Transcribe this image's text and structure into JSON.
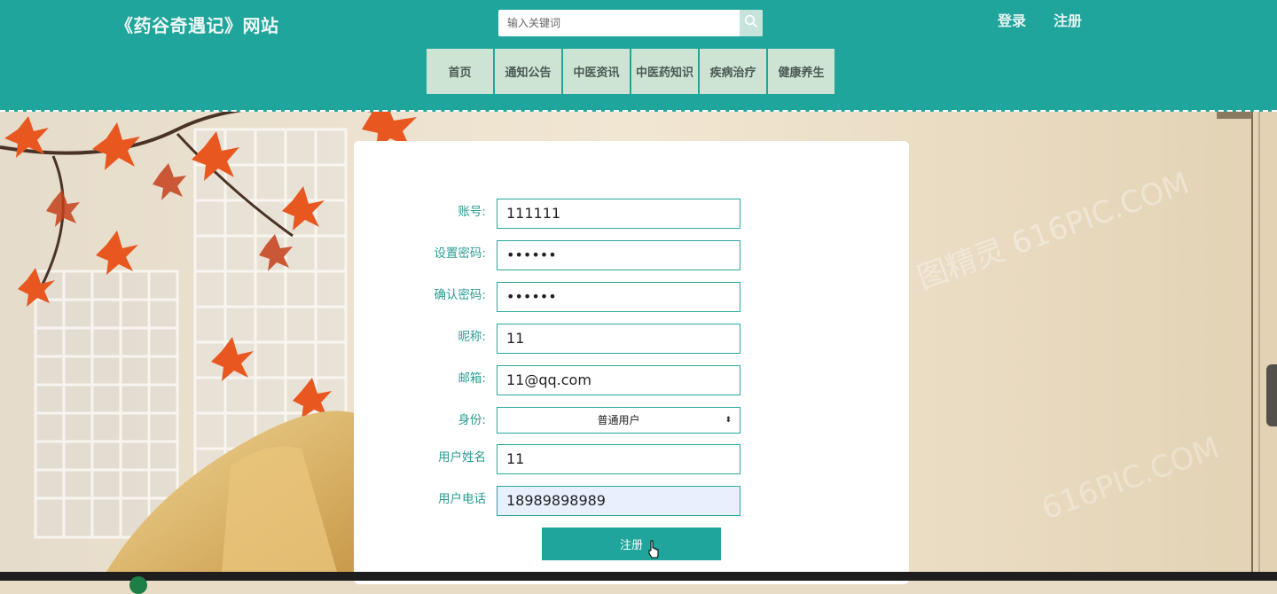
{
  "header": {
    "site_title": "《药谷奇遇记》网站",
    "search_placeholder": "输入关键词",
    "login_label": "登录",
    "register_label": "注册"
  },
  "nav": {
    "items": [
      "首页",
      "通知公告",
      "中医资讯",
      "中医药知识",
      "疾病治疗",
      "健康养生"
    ]
  },
  "form": {
    "account_label": "账号:",
    "account_value": "111111",
    "password_label": "设置密码:",
    "password_value": "••••••",
    "confirm_label": "确认密码:",
    "confirm_value": "••••••",
    "nickname_label": "昵称:",
    "nickname_value": "11",
    "email_label": "邮箱:",
    "email_value": "11@qq.com",
    "role_label": "身份:",
    "role_value": "普通用户",
    "realname_label": "用户姓名",
    "realname_value": "11",
    "phone_label": "用户电话",
    "phone_value": "18989898989",
    "submit_label": "注册"
  },
  "colors": {
    "brand": "#1fa59b",
    "nav_bg": "#cde4d4",
    "label": "#2a9c93"
  },
  "icons": {
    "search": "search-icon",
    "cursor": "hand-pointer-icon"
  }
}
